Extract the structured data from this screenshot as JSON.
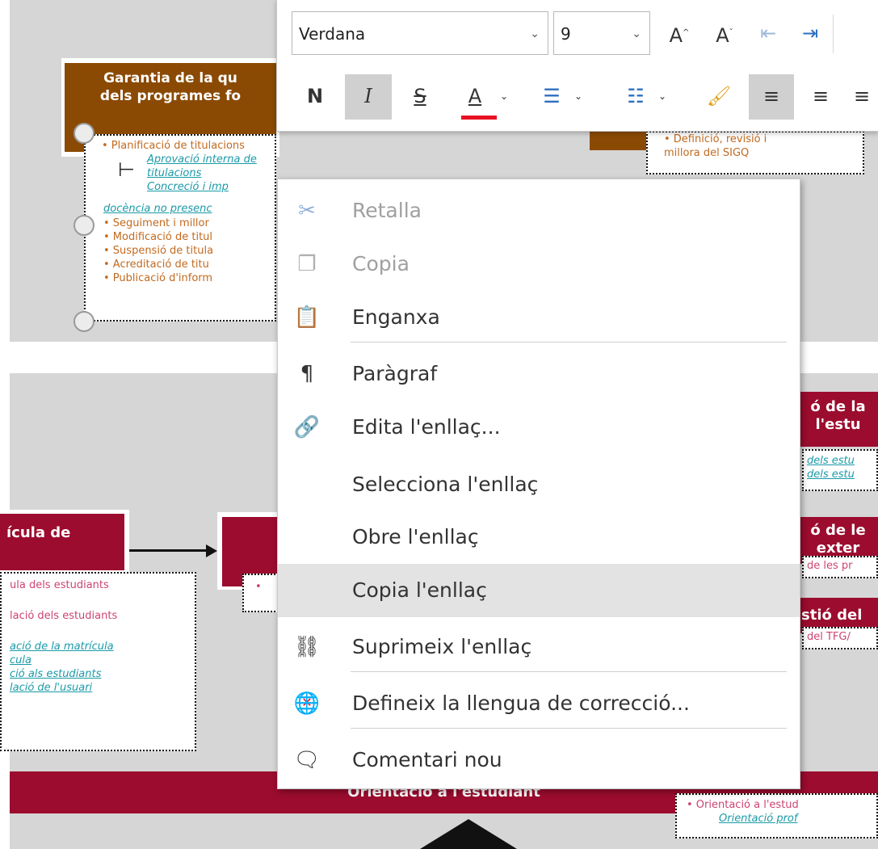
{
  "diagram": {
    "top_box_title_line1": "Garantia de la qu",
    "top_box_title_line2": "dels programes fo",
    "top_items": [
      "• Planificació de titulacions",
      "Aprovació interna de titulacions",
      "Concreció i imp",
      "docència no presenc",
      "• Seguiment i millor",
      "• Modificació de titul",
      "• Suspensió de titula",
      "• Acreditació de titu",
      "• Publicació d'inform"
    ],
    "right_top_items": [
      "• Definició, revisió i",
      "millora del SIGQ"
    ],
    "matricula_title": "ícula de",
    "matricula_items": [
      "ula  dels estudiants",
      "lació dels estudiants",
      "ació de la matrícula",
      "cula",
      "ció als estudiants",
      "lació de l'usuari"
    ],
    "center_bullet": "•",
    "right_box1_line1": "ó de la",
    "right_box1_line2": "l'estu",
    "right_box1_items": [
      "dels estu",
      "dels estu"
    ],
    "right_box2_line1": "ó de le",
    "right_box2_line2": "exter",
    "right_box2_item": "de les pr",
    "right_box3_title": "stió del",
    "right_box3_item": "del TFG/",
    "bottom_bar_label": "Orientació a l'estudiant",
    "bottom_right_items": [
      "• Orientació a l'estud",
      "Orientació prof"
    ]
  },
  "toolbar": {
    "font_name": "Verdana",
    "font_size": "9",
    "grow_font": "A",
    "shrink_font": "A",
    "bold_label": "N",
    "italic_label": "I",
    "strike_label": "S",
    "font_color_label": "A",
    "font_color": "#e81123"
  },
  "context_menu": {
    "items": [
      {
        "label": "Retalla",
        "icon": "scissors-icon",
        "enabled": false
      },
      {
        "label": "Copia",
        "icon": "copy-icon",
        "enabled": false
      },
      {
        "label": "Enganxa",
        "icon": "paste-icon",
        "enabled": true
      },
      {
        "label": "Paràgraf",
        "icon": "paragraph-icon",
        "enabled": true
      },
      {
        "label": "Edita l'enllaç...",
        "icon": "edit-link-icon",
        "enabled": true
      },
      {
        "label": "Selecciona l'enllaç",
        "icon": "",
        "enabled": true
      },
      {
        "label": "Obre l'enllaç",
        "icon": "",
        "enabled": true
      },
      {
        "label": "Copia l'enllaç",
        "icon": "",
        "enabled": true,
        "highlighted": true
      },
      {
        "label": "Suprimeix l'enllaç",
        "icon": "remove-link-icon",
        "enabled": true
      },
      {
        "label": "Defineix la llengua de correcció...",
        "icon": "language-icon",
        "enabled": true
      },
      {
        "label": "Comentari nou",
        "icon": "comment-icon",
        "enabled": true
      }
    ]
  },
  "colors": {
    "brown": "#8b4a04",
    "crimson": "#9c0c2e",
    "gray_bg": "#d6d6d6",
    "highlight": "#e3e3e3"
  }
}
